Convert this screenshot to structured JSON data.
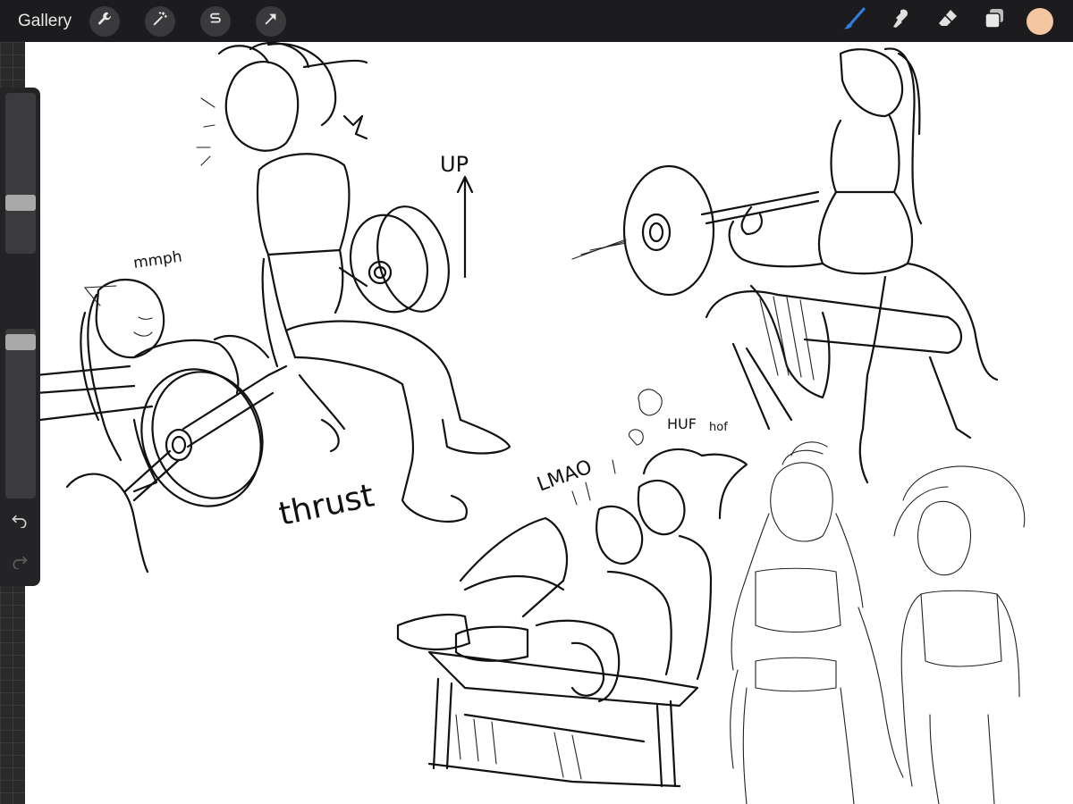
{
  "topbar": {
    "gallery_label": "Gallery",
    "actions": [
      {
        "icon": "wrench-icon"
      },
      {
        "icon": "magic-wand-icon"
      },
      {
        "icon": "selection-icon"
      },
      {
        "icon": "transform-arrow-icon"
      }
    ],
    "tools": [
      {
        "icon": "brush-icon",
        "active": true,
        "color": "#2f7fe0"
      },
      {
        "icon": "smudge-icon"
      },
      {
        "icon": "eraser-icon"
      },
      {
        "icon": "layers-icon"
      }
    ],
    "current_color": "#f4c7a2"
  },
  "sidebar": {
    "brush_size_level": 0.65,
    "opacity_level": 0.95,
    "buttons": [
      "modify-button-icon",
      "undo-icon",
      "redo-icon"
    ]
  },
  "canvas": {
    "annotations": [
      "UP",
      "mmph",
      "thrust",
      "LMAO",
      "HUF",
      "hof"
    ]
  }
}
